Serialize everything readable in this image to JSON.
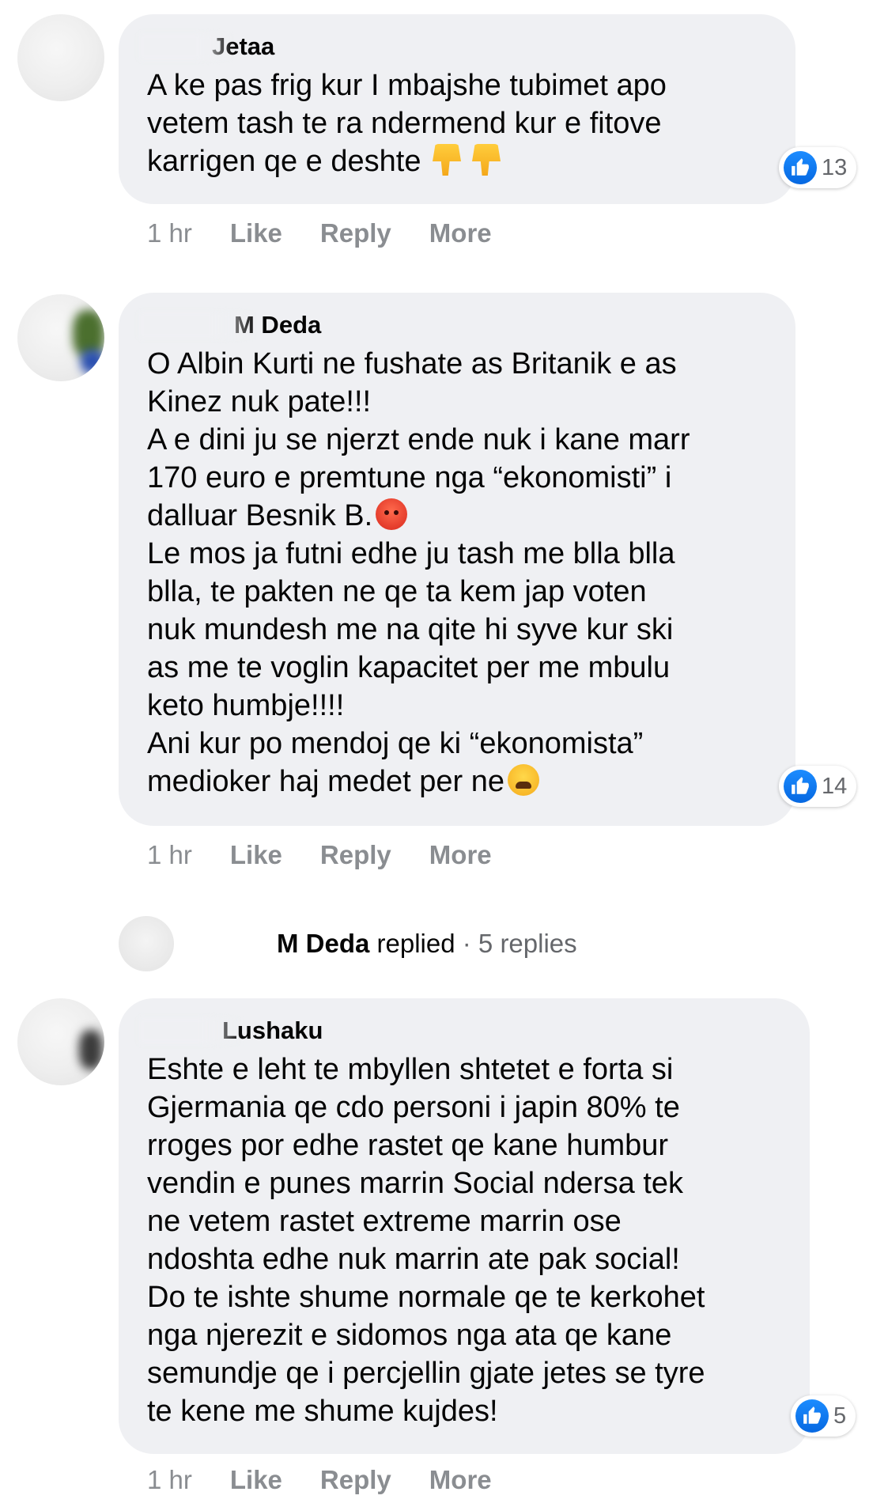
{
  "comments": [
    {
      "author": "Jetaa",
      "text": "A ke pas frig kur I mbajshe tubimet apo\nvetem tash te ra ndermend kur e fitove\nkarrigen qe e deshte ",
      "likes": "13",
      "actions": {
        "time": "1 hr",
        "like": "Like",
        "reply": "Reply",
        "more": "More"
      }
    },
    {
      "author": "M Deda",
      "text_part1": "O Albin Kurti ne fushate as Britanik e as\nKinez nuk pate!!!\nA e dini ju se njerzt ende nuk i kane marr\n170 euro e premtune nga “ekonomisti” i\ndalluar Besnik B.",
      "text_part2": "\nLe mos ja futni edhe ju tash me blla blla\nblla, te pakten ne qe ta kem jap voten\nnuk mundesh me na qite hi syve kur ski\nas me te voglin kapacitet per me mbulu\nketo humbje!!!!\nAni kur po mendoj qe ki “ekonomista”\nmedioker haj medet per ne",
      "likes": "14",
      "actions": {
        "time": "1 hr",
        "like": "Like",
        "reply": "Reply",
        "more": "More"
      }
    },
    {
      "author": "Lushaku",
      "text": "Eshte e leht te mbyllen shtetet e forta si\nGjermania qe cdo personi i japin 80% te\nrroges por edhe rastet qe kane humbur\nvendin e punes marrin Social ndersa tek\nne vetem rastet extreme marrin ose\nndoshta edhe nuk marrin ate pak social!\nDo te ishte shume normale qe te kerkohet\nnga njerezit e sidomos nga ata qe kane\nsemundje qe i percjellin gjate jetes se tyre\nte kene me shume kujdes!",
      "likes": "5",
      "actions": {
        "time": "1 hr",
        "like": "Like",
        "reply": "Reply",
        "more": "More"
      }
    }
  ],
  "reply_summary": {
    "name": "M Deda",
    "verb": " replied",
    "count": " · 5 replies"
  },
  "icons": {
    "like": "thumbs-up-icon",
    "thumbs_down_emoji": "thumbs-down-emoji",
    "angry_emoji": "angry-face-emoji",
    "weary_emoji": "weary-face-emoji"
  },
  "colors": {
    "bubble": "#eff0f3",
    "like_blue": "#1877f2",
    "meta_gray": "#8a8d91"
  }
}
